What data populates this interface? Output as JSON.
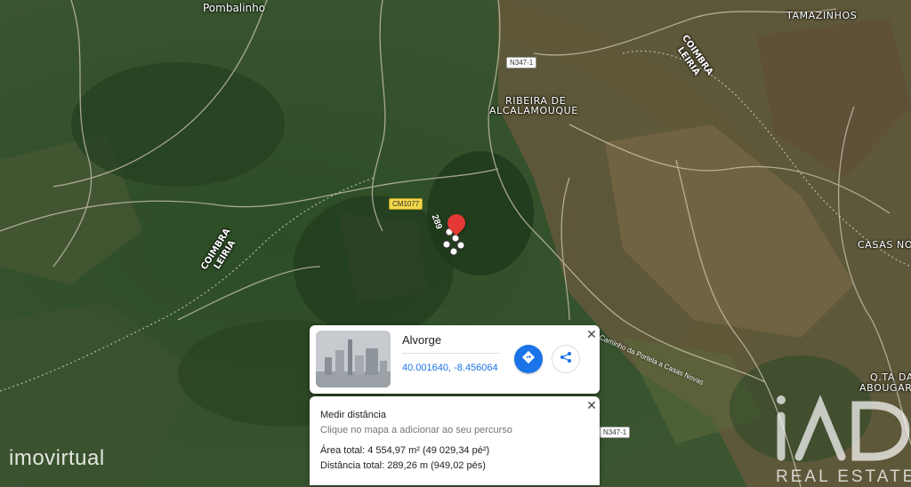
{
  "map": {
    "places": {
      "pombalinho": "Pombalinho",
      "tamazinhos": "TAMAZINHOS",
      "ribeira_line1": "RIBEIRA DE",
      "ribeira_line2": "ALCALAMOUQUE",
      "casas_novas": "CASAS NO",
      "qta_line1": "Q.TA DA",
      "qta_line2": "ABOUGAR"
    },
    "road_shields": {
      "n347_top": "N347-1",
      "cm1077": "CM1077",
      "n347_bottom": "N347-1"
    },
    "route_labels": {
      "left_line1": "COIMBRA",
      "left_line2": "LEIRIA",
      "right_line1": "COIMBRA",
      "right_line2": "LEIRIA"
    },
    "road_name": "Caminho da Portela a Casas Novas",
    "measure_badge": "289"
  },
  "place_card": {
    "title": "Alvorge",
    "coordinates": "40.001640, -8.456064",
    "close_glyph": "✕"
  },
  "measure_card": {
    "title": "Medir distância",
    "hint": "Clique no mapa a adicionar ao seu percurso",
    "area": "Área total: 4 554,97 m² (49 029,34 pé²)",
    "distance": "Distância total: 289,26 m (949,02 pés)",
    "close_glyph": "✕"
  },
  "watermarks": {
    "left": "imovirtual",
    "right_text": "REAL ESTATE",
    "right_logo": "iAD"
  },
  "colors": {
    "accent": "#1a73e8",
    "pin": "#e53935",
    "shield": "#f0d64a"
  },
  "icons": {
    "directions": "directions-icon",
    "share": "share-icon",
    "close": "close-icon",
    "pin": "map-pin-icon"
  }
}
